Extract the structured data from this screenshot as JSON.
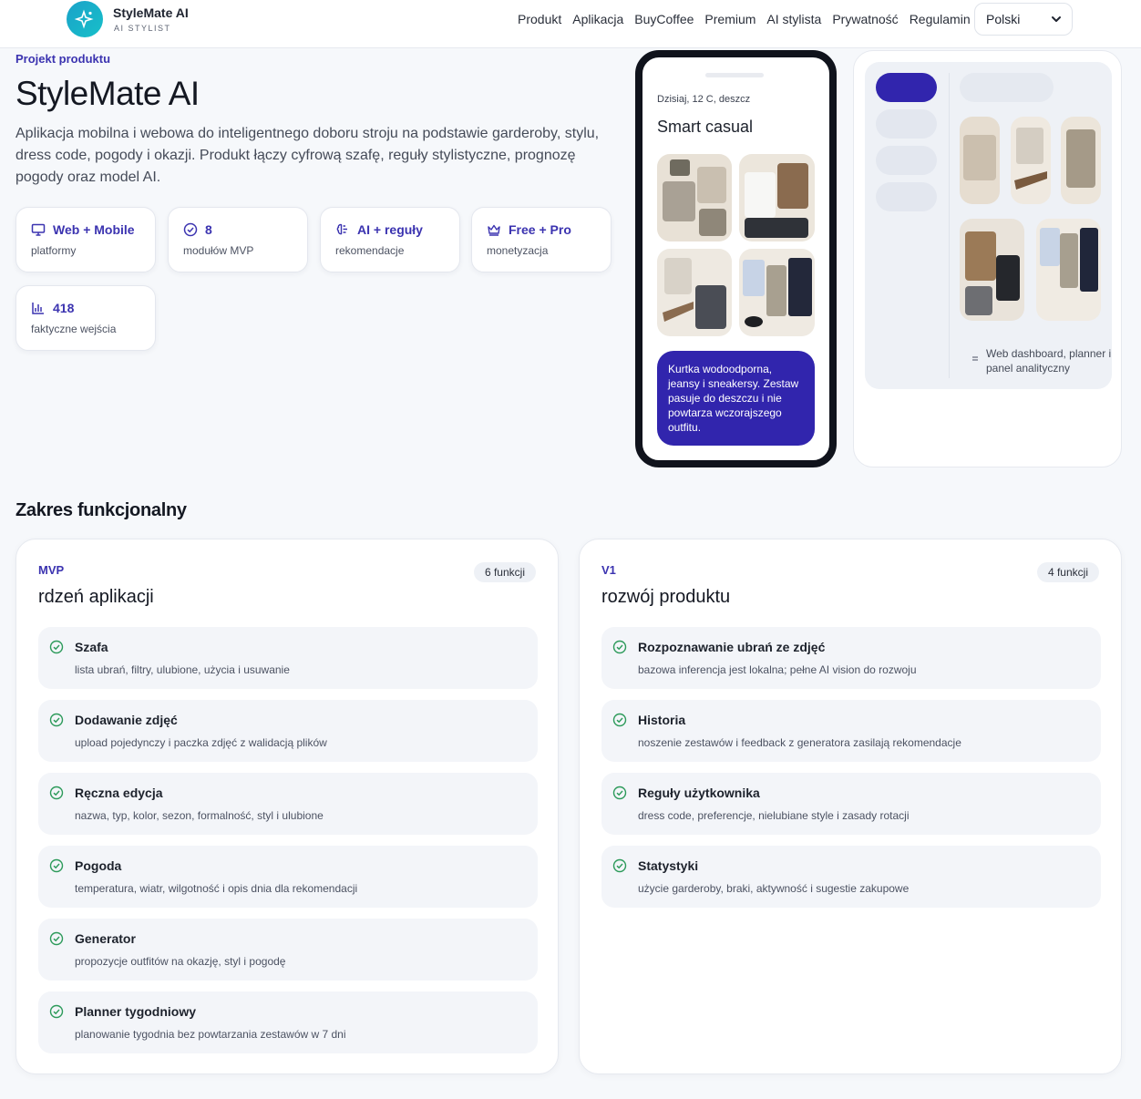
{
  "header": {
    "brand_name": "StyleMate AI",
    "brand_sub": "AI STYLIST",
    "nav": [
      "Produkt",
      "Aplikacja",
      "BuyCoffee",
      "Premium",
      "AI stylista",
      "Prywatność",
      "Regulamin"
    ],
    "language": "Polski"
  },
  "hero": {
    "kicker": "Projekt produktu",
    "title": "StyleMate AI",
    "description": "Aplikacja mobilna i webowa do inteligentnego doboru stroju na podstawie garderoby, stylu, dress code, pogody i okazji. Produkt łączy cyfrową szafę, reguły stylistyczne, prognozę pogody oraz model AI."
  },
  "stats": [
    {
      "icon": "monitor-icon",
      "value": "Web + Mobile",
      "label": "platformy"
    },
    {
      "icon": "check-circle-icon",
      "value": "8",
      "label": "modułów MVP"
    },
    {
      "icon": "brain-icon",
      "value": "AI + reguły",
      "label": "rekomendacje"
    },
    {
      "icon": "crown-icon",
      "value": "Free + Pro",
      "label": "monetyzacja"
    },
    {
      "icon": "bar-chart-icon",
      "value": "418",
      "label": "faktyczne wejścia"
    }
  ],
  "phone": {
    "weather": "Dzisiaj, 12 C, deszcz",
    "title": "Smart casual",
    "message": "Kurtka wodoodporna, jeansy i sneakersy. Zestaw pasuje do deszczu i nie powtarza wczorajszego outfitu."
  },
  "dashboard": {
    "caption": "Web dashboard, planner i panel analityczny"
  },
  "features": {
    "section_title": "Zakres funkcjonalny",
    "cards": [
      {
        "tag": "MVP",
        "title": "rdzeń aplikacji",
        "count": "6 funkcji",
        "items": [
          {
            "name": "Szafa",
            "desc": "lista ubrań, filtry, ulubione, użycia i usuwanie"
          },
          {
            "name": "Dodawanie zdjęć",
            "desc": "upload pojedynczy i paczka zdjęć z walidacją plików"
          },
          {
            "name": "Ręczna edycja",
            "desc": "nazwa, typ, kolor, sezon, formalność, styl i ulubione"
          },
          {
            "name": "Pogoda",
            "desc": "temperatura, wiatr, wilgotność i opis dnia dla rekomendacji"
          },
          {
            "name": "Generator",
            "desc": "propozycje outfitów na okazję, styl i pogodę"
          },
          {
            "name": "Planner tygodniowy",
            "desc": "planowanie tygodnia bez powtarzania zestawów w 7 dni"
          }
        ]
      },
      {
        "tag": "V1",
        "title": "rozwój produktu",
        "count": "4 funkcji",
        "items": [
          {
            "name": "Rozpoznawanie ubrań ze zdjęć",
            "desc": "bazowa inferencja jest lokalna; pełne AI vision do rozwoju"
          },
          {
            "name": "Historia",
            "desc": "noszenie zestawów i feedback z generatora zasilają rekomendacje"
          },
          {
            "name": "Reguły użytkownika",
            "desc": "dress code, preferencje, nielubiane style i zasady rotacji"
          },
          {
            "name": "Statystyki",
            "desc": "użycie garderoby, braki, aktywność i sugestie zakupowe"
          }
        ]
      }
    ]
  },
  "colors": {
    "accent": "#3b33b0",
    "brand": "#1aa2c9",
    "check": "#2c9a5a"
  }
}
